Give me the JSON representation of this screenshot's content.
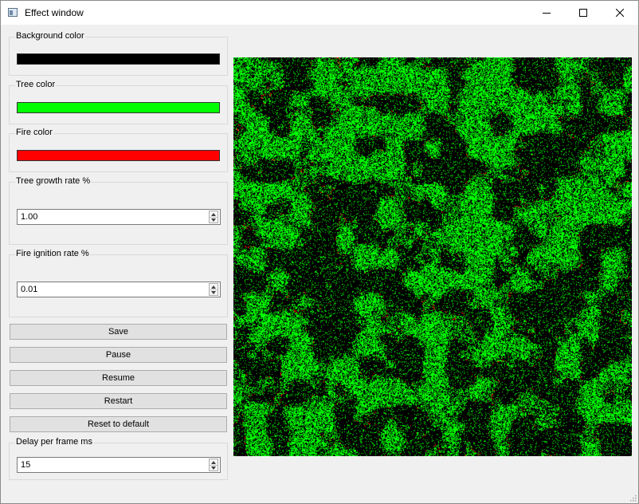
{
  "window": {
    "title": "Effect window"
  },
  "panel": {
    "background_color": {
      "label": "Background color",
      "value": "#000000"
    },
    "tree_color": {
      "label": "Tree color",
      "value": "#00ff00"
    },
    "fire_color": {
      "label": "Fire color",
      "value": "#ff0000"
    },
    "tree_growth_rate": {
      "label": "Tree growth rate %",
      "value": "1.00"
    },
    "fire_ignition_rate": {
      "label": "Fire ignition rate %",
      "value": "0.01"
    },
    "buttons": {
      "save": "Save",
      "pause": "Pause",
      "resume": "Resume",
      "restart": "Restart",
      "reset": "Reset to default"
    },
    "delay_per_frame": {
      "label": "Delay per frame ms",
      "value": "15"
    }
  },
  "simulation": {
    "tree_color": "#00ff00",
    "fire_color": "#ff0000",
    "background_color": "#000000"
  },
  "icons": {
    "app": "app-window-icon",
    "minimize": "minimize-icon",
    "maximize": "maximize-icon",
    "close": "close-icon",
    "spin_up": "chevron-up-icon",
    "spin_down": "chevron-down-icon",
    "resize": "resize-grip-icon"
  }
}
